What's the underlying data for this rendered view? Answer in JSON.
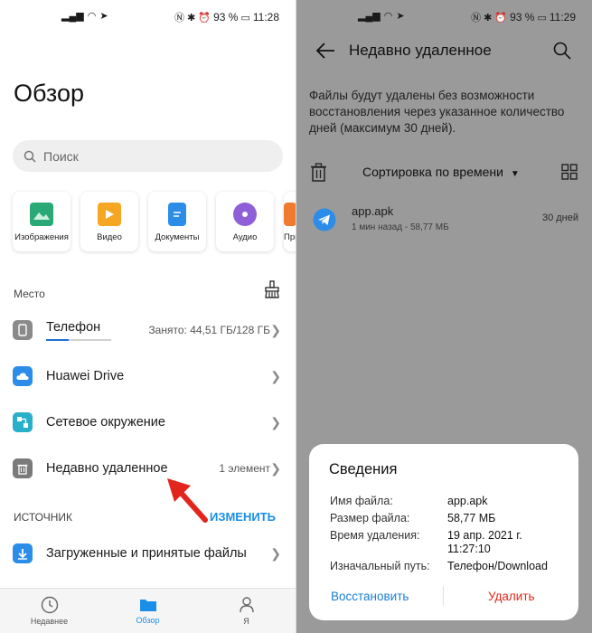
{
  "left": {
    "status": {
      "battery": "93 %",
      "time": "11:28"
    },
    "title": "Обзор",
    "search": {
      "placeholder": "Поиск"
    },
    "categories": [
      {
        "label": "Изображения",
        "color": "#2aa876"
      },
      {
        "label": "Видео",
        "color": "#f5a623"
      },
      {
        "label": "Документы",
        "color": "#2b8de8"
      },
      {
        "label": "Аудио",
        "color": "#8e5fd6"
      },
      {
        "label": "При",
        "color": "#f07a2e"
      }
    ],
    "location_label": "Место",
    "locations": [
      {
        "label": "Телефон",
        "right": "Занято: 44,51 ГБ/128 ГБ"
      },
      {
        "label": "Huawei Drive",
        "right": ""
      },
      {
        "label": "Сетевое окружение",
        "right": ""
      },
      {
        "label": "Недавно удаленное",
        "right": "1 элемент"
      }
    ],
    "phone_usage": 0.35,
    "source_label": "ИСТОЧНИК",
    "source_action": "ИЗМЕНИТЬ",
    "sources": [
      {
        "label": "Загруженные и принятые файлы"
      }
    ],
    "nav": [
      {
        "label": "Недавнее",
        "icon": "clock-icon"
      },
      {
        "label": "Обзор",
        "icon": "folder-icon"
      },
      {
        "label": "Я",
        "icon": "person-icon"
      }
    ]
  },
  "right": {
    "status": {
      "battery": "93 %",
      "time": "11:29"
    },
    "title": "Недавно удаленное",
    "description": "Файлы будут удалены без возможности восстановления через указанное количество дней (максимум 30 дней).",
    "sort_label": "Сортировка по времени",
    "file": {
      "name": "app.apk",
      "meta": "1 мин назад - 58,77 МБ",
      "days": "30 дней"
    },
    "details": {
      "title": "Сведения",
      "rows": [
        {
          "key": "Имя файла:",
          "value": "app.apk"
        },
        {
          "key": "Размер файла:",
          "value": "58,77 МБ"
        },
        {
          "key": "Время удаления:",
          "value": "19 апр. 2021 г. 11:27:10"
        },
        {
          "key": "Изначальный путь:",
          "value": "Телефон/Download"
        }
      ],
      "restore": "Восстановить",
      "delete": "Удалить",
      "restore_color": "#1a7fd6",
      "delete_color": "#e3261b"
    }
  }
}
